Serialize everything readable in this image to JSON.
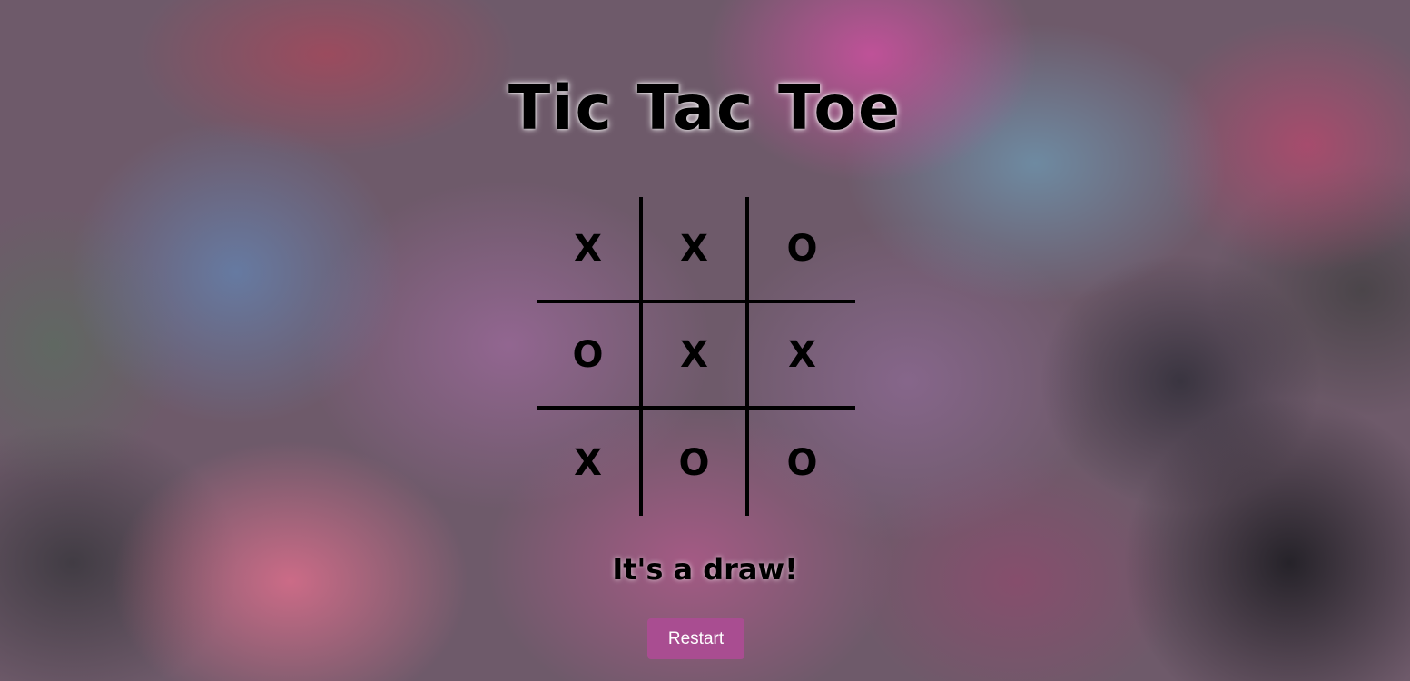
{
  "game": {
    "title": "Tic Tac Toe",
    "board": [
      [
        "X",
        "X",
        "O"
      ],
      [
        "O",
        "X",
        "X"
      ],
      [
        "X",
        "O",
        "O"
      ]
    ],
    "status": "It's a draw!",
    "restart_label": "Restart"
  },
  "colors": {
    "button_bg": "#a94d91",
    "button_text": "#ffffff",
    "ink": "#000000"
  }
}
